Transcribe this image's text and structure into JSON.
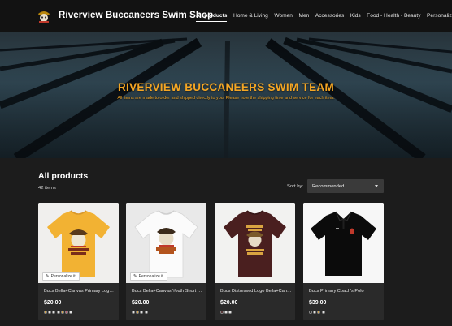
{
  "header": {
    "store_title": "Riverview Buccaneers Swim Shop",
    "nav": [
      {
        "label": "All products",
        "active": true
      },
      {
        "label": "Home & Living",
        "active": false
      },
      {
        "label": "Women",
        "active": false
      },
      {
        "label": "Men",
        "active": false
      },
      {
        "label": "Accessories",
        "active": false
      },
      {
        "label": "Kids",
        "active": false
      },
      {
        "label": "Food - Health - Beauty",
        "active": false
      },
      {
        "label": "Personalize",
        "active": false
      }
    ]
  },
  "hero": {
    "title": "RIVERVIEW BUCCANEERS SWIM TEAM",
    "subtitle": "All items are made to order and shipped directly to you. Please note the shipping time and service for each item."
  },
  "products_section": {
    "title": "All products",
    "count": "42 items",
    "sort_label": "Sort by:",
    "sort_value": "Recommended"
  },
  "products": [
    {
      "name": "Bucs Bella+Canvas Primary Logo Tee",
      "price": "$20.00",
      "personalize_label": "Personalize it",
      "shirt_color": "#f2b233",
      "swatches": [
        "#f2b233",
        "#ffffff",
        "#ffffff",
        "#ffffff",
        "#f2b233",
        "#d14a6e",
        "#ffffff"
      ]
    },
    {
      "name": "Bucs Bella+Canvas Youth Short Sleeve Tee",
      "price": "$20.00",
      "personalize_label": "Personalize it",
      "shirt_color": "#ffffff",
      "swatches": [
        "#ffffff",
        "#f2b233",
        "#ffffff",
        "#ffffff"
      ]
    },
    {
      "name": "Bucs Distressed Logo Bella+Canvas Tee",
      "price": "$20.00",
      "personalize_label": "",
      "shirt_color": "#4a1f1f",
      "swatches": [
        "#4a1f1f",
        "#ffffff",
        "#ffffff"
      ]
    },
    {
      "name": "Bucs Primary Coach's Polo",
      "price": "$39.00",
      "personalize_label": "",
      "shirt_color": "#0a0a0a",
      "swatches": [
        "#111111",
        "#ffffff",
        "#f2b233",
        "#ffffff"
      ]
    }
  ],
  "colors": {
    "accent": "#f5a623",
    "page_bg": "#1c1c1c",
    "header_bg": "#121212",
    "card_bg": "#2a2a2a"
  }
}
